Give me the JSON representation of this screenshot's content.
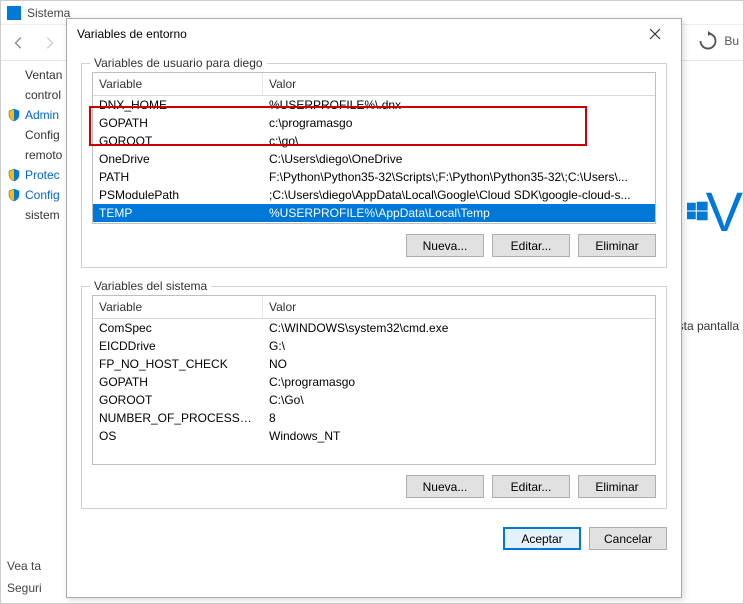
{
  "bg": {
    "title": "Sistema",
    "bu": "Bu",
    "sidebar": [
      {
        "shield": false,
        "text": "Ventan",
        "sub": "control"
      },
      {
        "shield": true,
        "text": "Admin"
      },
      {
        "shield": false,
        "text": "Config",
        "sub": "remoto"
      },
      {
        "shield": true,
        "text": "Protec"
      },
      {
        "shield": true,
        "text": "Config",
        "sub": "sistem"
      }
    ],
    "sta": "sta pantalla",
    "vea": "Vea ta",
    "seguri": "Seguri",
    "win_letter": "V"
  },
  "dlg": {
    "title": "Variables de entorno",
    "user_group_label": "Variables de usuario para diego",
    "sys_group_label": "Variables del sistema",
    "col_variable": "Variable",
    "col_valor": "Valor",
    "user_vars": [
      {
        "name": "DNX_HOME",
        "value": "%USERPROFILE%\\.dnx"
      },
      {
        "name": "GOPATH",
        "value": "c:\\programasgo"
      },
      {
        "name": "GOROOT",
        "value": "c:\\go\\"
      },
      {
        "name": "OneDrive",
        "value": "C:\\Users\\diego\\OneDrive"
      },
      {
        "name": "PATH",
        "value": "F:\\Python\\Python35-32\\Scripts\\;F:\\Python\\Python35-32\\;C:\\Users\\..."
      },
      {
        "name": "PSModulePath",
        "value": ";C:\\Users\\diego\\AppData\\Local\\Google\\Cloud SDK\\google-cloud-s..."
      },
      {
        "name": "TEMP",
        "value": "%USERPROFILE%\\AppData\\Local\\Temp",
        "selected": true
      }
    ],
    "sys_vars": [
      {
        "name": "ComSpec",
        "value": "C:\\WINDOWS\\system32\\cmd.exe"
      },
      {
        "name": "EICDDrive",
        "value": "G:\\"
      },
      {
        "name": "FP_NO_HOST_CHECK",
        "value": "NO"
      },
      {
        "name": "GOPATH",
        "value": "C:\\programasgo"
      },
      {
        "name": "GOROOT",
        "value": "C:\\Go\\"
      },
      {
        "name": "NUMBER_OF_PROCESSORS",
        "value": "8"
      },
      {
        "name": "OS",
        "value": "Windows_NT"
      }
    ],
    "buttons": {
      "nueva": "Nueva...",
      "editar": "Editar...",
      "eliminar": "Eliminar",
      "aceptar": "Aceptar",
      "cancelar": "Cancelar"
    }
  }
}
